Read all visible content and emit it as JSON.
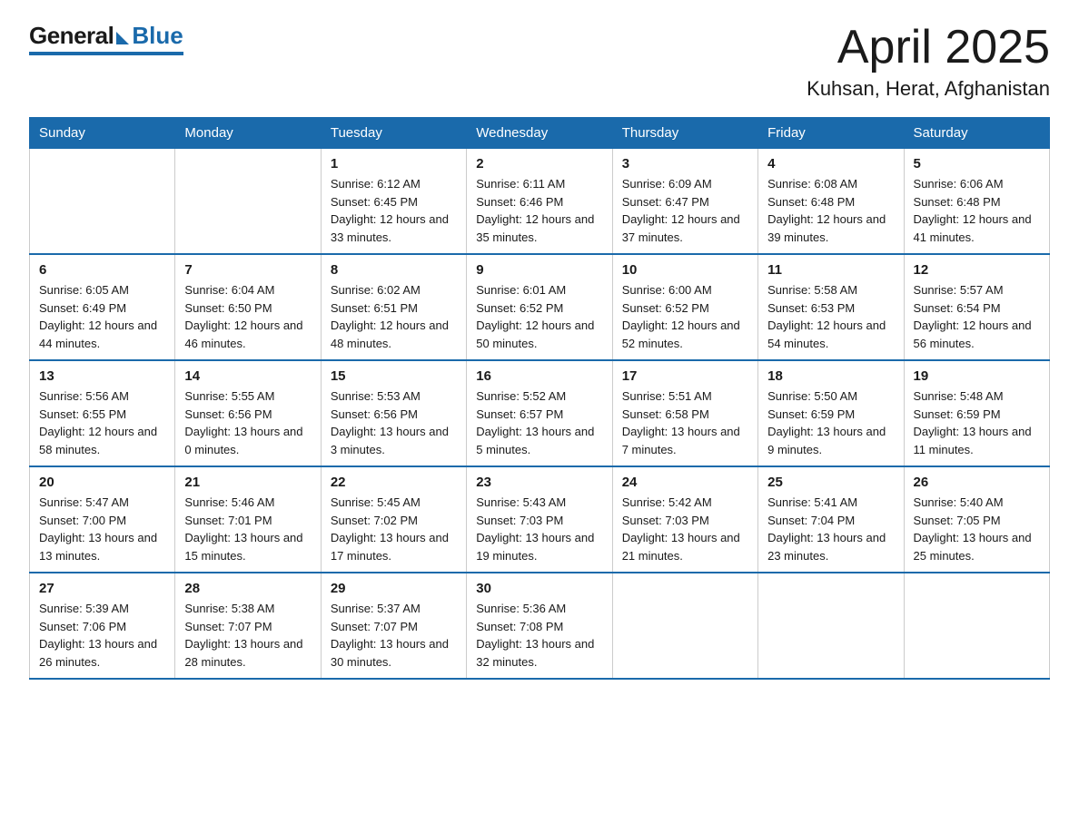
{
  "logo": {
    "general": "General",
    "blue": "Blue",
    "subtitle": "Blue"
  },
  "title": {
    "month_year": "April 2025",
    "location": "Kuhsan, Herat, Afghanistan"
  },
  "headers": [
    "Sunday",
    "Monday",
    "Tuesday",
    "Wednesday",
    "Thursday",
    "Friday",
    "Saturday"
  ],
  "weeks": [
    [
      {
        "day": "",
        "sunrise": "",
        "sunset": "",
        "daylight": ""
      },
      {
        "day": "",
        "sunrise": "",
        "sunset": "",
        "daylight": ""
      },
      {
        "day": "1",
        "sunrise": "Sunrise: 6:12 AM",
        "sunset": "Sunset: 6:45 PM",
        "daylight": "Daylight: 12 hours and 33 minutes."
      },
      {
        "day": "2",
        "sunrise": "Sunrise: 6:11 AM",
        "sunset": "Sunset: 6:46 PM",
        "daylight": "Daylight: 12 hours and 35 minutes."
      },
      {
        "day": "3",
        "sunrise": "Sunrise: 6:09 AM",
        "sunset": "Sunset: 6:47 PM",
        "daylight": "Daylight: 12 hours and 37 minutes."
      },
      {
        "day": "4",
        "sunrise": "Sunrise: 6:08 AM",
        "sunset": "Sunset: 6:48 PM",
        "daylight": "Daylight: 12 hours and 39 minutes."
      },
      {
        "day": "5",
        "sunrise": "Sunrise: 6:06 AM",
        "sunset": "Sunset: 6:48 PM",
        "daylight": "Daylight: 12 hours and 41 minutes."
      }
    ],
    [
      {
        "day": "6",
        "sunrise": "Sunrise: 6:05 AM",
        "sunset": "Sunset: 6:49 PM",
        "daylight": "Daylight: 12 hours and 44 minutes."
      },
      {
        "day": "7",
        "sunrise": "Sunrise: 6:04 AM",
        "sunset": "Sunset: 6:50 PM",
        "daylight": "Daylight: 12 hours and 46 minutes."
      },
      {
        "day": "8",
        "sunrise": "Sunrise: 6:02 AM",
        "sunset": "Sunset: 6:51 PM",
        "daylight": "Daylight: 12 hours and 48 minutes."
      },
      {
        "day": "9",
        "sunrise": "Sunrise: 6:01 AM",
        "sunset": "Sunset: 6:52 PM",
        "daylight": "Daylight: 12 hours and 50 minutes."
      },
      {
        "day": "10",
        "sunrise": "Sunrise: 6:00 AM",
        "sunset": "Sunset: 6:52 PM",
        "daylight": "Daylight: 12 hours and 52 minutes."
      },
      {
        "day": "11",
        "sunrise": "Sunrise: 5:58 AM",
        "sunset": "Sunset: 6:53 PM",
        "daylight": "Daylight: 12 hours and 54 minutes."
      },
      {
        "day": "12",
        "sunrise": "Sunrise: 5:57 AM",
        "sunset": "Sunset: 6:54 PM",
        "daylight": "Daylight: 12 hours and 56 minutes."
      }
    ],
    [
      {
        "day": "13",
        "sunrise": "Sunrise: 5:56 AM",
        "sunset": "Sunset: 6:55 PM",
        "daylight": "Daylight: 12 hours and 58 minutes."
      },
      {
        "day": "14",
        "sunrise": "Sunrise: 5:55 AM",
        "sunset": "Sunset: 6:56 PM",
        "daylight": "Daylight: 13 hours and 0 minutes."
      },
      {
        "day": "15",
        "sunrise": "Sunrise: 5:53 AM",
        "sunset": "Sunset: 6:56 PM",
        "daylight": "Daylight: 13 hours and 3 minutes."
      },
      {
        "day": "16",
        "sunrise": "Sunrise: 5:52 AM",
        "sunset": "Sunset: 6:57 PM",
        "daylight": "Daylight: 13 hours and 5 minutes."
      },
      {
        "day": "17",
        "sunrise": "Sunrise: 5:51 AM",
        "sunset": "Sunset: 6:58 PM",
        "daylight": "Daylight: 13 hours and 7 minutes."
      },
      {
        "day": "18",
        "sunrise": "Sunrise: 5:50 AM",
        "sunset": "Sunset: 6:59 PM",
        "daylight": "Daylight: 13 hours and 9 minutes."
      },
      {
        "day": "19",
        "sunrise": "Sunrise: 5:48 AM",
        "sunset": "Sunset: 6:59 PM",
        "daylight": "Daylight: 13 hours and 11 minutes."
      }
    ],
    [
      {
        "day": "20",
        "sunrise": "Sunrise: 5:47 AM",
        "sunset": "Sunset: 7:00 PM",
        "daylight": "Daylight: 13 hours and 13 minutes."
      },
      {
        "day": "21",
        "sunrise": "Sunrise: 5:46 AM",
        "sunset": "Sunset: 7:01 PM",
        "daylight": "Daylight: 13 hours and 15 minutes."
      },
      {
        "day": "22",
        "sunrise": "Sunrise: 5:45 AM",
        "sunset": "Sunset: 7:02 PM",
        "daylight": "Daylight: 13 hours and 17 minutes."
      },
      {
        "day": "23",
        "sunrise": "Sunrise: 5:43 AM",
        "sunset": "Sunset: 7:03 PM",
        "daylight": "Daylight: 13 hours and 19 minutes."
      },
      {
        "day": "24",
        "sunrise": "Sunrise: 5:42 AM",
        "sunset": "Sunset: 7:03 PM",
        "daylight": "Daylight: 13 hours and 21 minutes."
      },
      {
        "day": "25",
        "sunrise": "Sunrise: 5:41 AM",
        "sunset": "Sunset: 7:04 PM",
        "daylight": "Daylight: 13 hours and 23 minutes."
      },
      {
        "day": "26",
        "sunrise": "Sunrise: 5:40 AM",
        "sunset": "Sunset: 7:05 PM",
        "daylight": "Daylight: 13 hours and 25 minutes."
      }
    ],
    [
      {
        "day": "27",
        "sunrise": "Sunrise: 5:39 AM",
        "sunset": "Sunset: 7:06 PM",
        "daylight": "Daylight: 13 hours and 26 minutes."
      },
      {
        "day": "28",
        "sunrise": "Sunrise: 5:38 AM",
        "sunset": "Sunset: 7:07 PM",
        "daylight": "Daylight: 13 hours and 28 minutes."
      },
      {
        "day": "29",
        "sunrise": "Sunrise: 5:37 AM",
        "sunset": "Sunset: 7:07 PM",
        "daylight": "Daylight: 13 hours and 30 minutes."
      },
      {
        "day": "30",
        "sunrise": "Sunrise: 5:36 AM",
        "sunset": "Sunset: 7:08 PM",
        "daylight": "Daylight: 13 hours and 32 minutes."
      },
      {
        "day": "",
        "sunrise": "",
        "sunset": "",
        "daylight": ""
      },
      {
        "day": "",
        "sunrise": "",
        "sunset": "",
        "daylight": ""
      },
      {
        "day": "",
        "sunrise": "",
        "sunset": "",
        "daylight": ""
      }
    ]
  ]
}
